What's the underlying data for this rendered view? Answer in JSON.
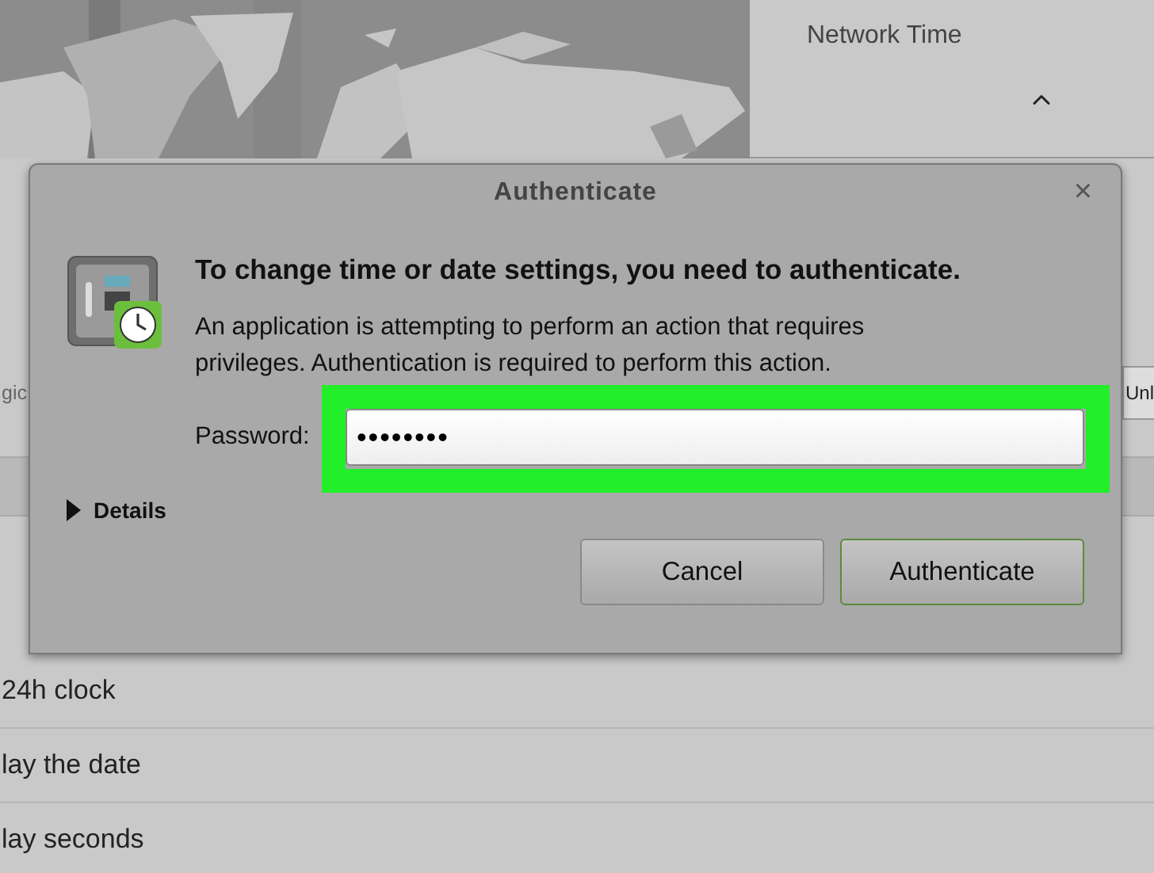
{
  "background": {
    "side_panel": {
      "title": "Network Time"
    },
    "hidden_row": {
      "left_label": "gic",
      "right_button": "Unl"
    },
    "settings_rows": [
      {
        "label": "24h clock"
      },
      {
        "label": "lay the date"
      },
      {
        "label": "lay seconds"
      }
    ]
  },
  "dialog": {
    "title": "Authenticate",
    "close": "×",
    "heading": "To change time or date settings, you need to authenticate.",
    "message": "An application is attempting to perform an action that requires privileges. Authentication is required to perform this action.",
    "password": {
      "label": "Password:",
      "value": "••••••••"
    },
    "details": {
      "label": "Details",
      "expanded": false
    },
    "buttons": [
      {
        "label": "Cancel",
        "default": false
      },
      {
        "label": "Authenticate",
        "default": true
      }
    ]
  },
  "highlight_password": true
}
